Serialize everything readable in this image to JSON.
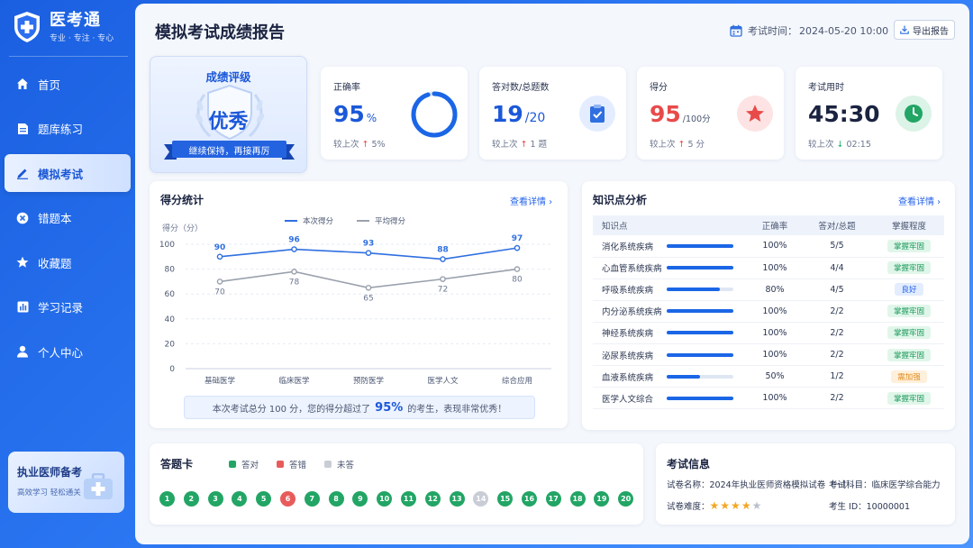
{
  "app": {
    "name": "医考通",
    "slogan": "专业 · 专注 · 专心"
  },
  "sidebar": {
    "items": [
      {
        "label": "首页",
        "icon": "home-icon",
        "active": false
      },
      {
        "label": "题库练习",
        "icon": "document-icon",
        "active": false
      },
      {
        "label": "模拟考试",
        "icon": "pencil-icon",
        "active": true
      },
      {
        "label": "错题本",
        "icon": "close-circle-icon",
        "active": false
      },
      {
        "label": "收藏题",
        "icon": "star-icon",
        "active": false
      },
      {
        "label": "学习记录",
        "icon": "bar-chart-icon",
        "active": false
      },
      {
        "label": "个人中心",
        "icon": "user-icon",
        "active": false
      }
    ],
    "promo": {
      "title": "执业医师备考",
      "subtitle": "高效学习 轻松通关"
    }
  },
  "header": {
    "title": "模拟考试成绩报告",
    "exam_time_label": "考试时间：",
    "exam_time": "2024-05-20 10:00",
    "export_label": "导出报告"
  },
  "grade": {
    "label": "成绩评级",
    "value": "优秀",
    "ribbon": "继续保持，再接再厉"
  },
  "stats": {
    "accuracy": {
      "title": "正确率",
      "value": "95",
      "unit": "%",
      "compare_prefix": "较上次",
      "arrow": "↑",
      "delta": "5%",
      "fraction": 0.95
    },
    "correct": {
      "title": "答对数/总题数",
      "value": "19",
      "unit": "/20",
      "compare_prefix": "较上次",
      "arrow": "↑",
      "delta": "1 题"
    },
    "score": {
      "title": "得分",
      "value": "95",
      "unit": "/100分",
      "compare_prefix": "较上次",
      "arrow": "↑",
      "delta": "5 分"
    },
    "duration": {
      "title": "考试用时",
      "value": "45:30",
      "compare_prefix": "较上次",
      "arrow": "↓",
      "delta": "02:15"
    }
  },
  "score_chart": {
    "title": "得分统计",
    "link": "查看详情 ›",
    "summary_before": "本次考试总分 100 分，您的得分超过了",
    "summary_pct": "95%",
    "summary_after": "的考生，表现非常优秀！"
  },
  "chart_data": {
    "type": "line",
    "ylabel": "得分（分）",
    "ylim": [
      0,
      100
    ],
    "yticks": [
      0,
      20,
      40,
      60,
      80,
      100
    ],
    "categories": [
      "基础医学",
      "临床医学",
      "预防医学",
      "医学人文",
      "综合应用"
    ],
    "series": [
      {
        "name": "本次得分",
        "values": [
          90,
          96,
          93,
          88,
          97
        ],
        "color": "#2f6fe0"
      },
      {
        "name": "平均得分",
        "values": [
          70,
          78,
          65,
          72,
          80
        ],
        "color": "#9aa1ad"
      }
    ],
    "grid": true,
    "legend": "top-center"
  },
  "knowledge": {
    "title": "知识点分析",
    "link": "查看详情 ›",
    "headers": [
      "知识点",
      "正确率",
      "答对/总题",
      "掌握程度"
    ],
    "rows": [
      {
        "name": "消化系统疾病",
        "rate": "100%",
        "fraction": 1.0,
        "answered": "5/5",
        "level": "掌握牢固",
        "level_type": "good"
      },
      {
        "name": "心血管系统疾病",
        "rate": "100%",
        "fraction": 1.0,
        "answered": "4/4",
        "level": "掌握牢固",
        "level_type": "good"
      },
      {
        "name": "呼吸系统疾病",
        "rate": "80%",
        "fraction": 0.8,
        "answered": "4/5",
        "level": "良好",
        "level_type": "ok"
      },
      {
        "name": "内分泌系统疾病",
        "rate": "100%",
        "fraction": 1.0,
        "answered": "2/2",
        "level": "掌握牢固",
        "level_type": "good"
      },
      {
        "name": "神经系统疾病",
        "rate": "100%",
        "fraction": 1.0,
        "answered": "2/2",
        "level": "掌握牢固",
        "level_type": "good"
      },
      {
        "name": "泌尿系统疾病",
        "rate": "100%",
        "fraction": 1.0,
        "answered": "2/2",
        "level": "掌握牢固",
        "level_type": "good"
      },
      {
        "name": "血液系统疾病",
        "rate": "50%",
        "fraction": 0.5,
        "answered": "1/2",
        "level": "需加强",
        "level_type": "weak"
      },
      {
        "name": "医学人文综合",
        "rate": "100%",
        "fraction": 1.0,
        "answered": "2/2",
        "level": "掌握牢固",
        "level_type": "good"
      }
    ]
  },
  "answer_sheet": {
    "title": "答题卡",
    "legend": {
      "correct": "答对",
      "wrong": "答错",
      "unanswered": "未答"
    },
    "colors": {
      "correct": "#22a565",
      "wrong": "#e85b5b",
      "unanswered": "#c9cdd6"
    },
    "questions": [
      {
        "no": "1",
        "status": "correct"
      },
      {
        "no": "2",
        "status": "correct"
      },
      {
        "no": "3",
        "status": "correct"
      },
      {
        "no": "4",
        "status": "correct"
      },
      {
        "no": "5",
        "status": "correct"
      },
      {
        "no": "6",
        "status": "wrong"
      },
      {
        "no": "7",
        "status": "correct"
      },
      {
        "no": "8",
        "status": "correct"
      },
      {
        "no": "9",
        "status": "correct"
      },
      {
        "no": "10",
        "status": "correct"
      },
      {
        "no": "11",
        "status": "correct"
      },
      {
        "no": "12",
        "status": "correct"
      },
      {
        "no": "13",
        "status": "correct"
      },
      {
        "no": "14",
        "status": "unanswered"
      },
      {
        "no": "15",
        "status": "correct"
      },
      {
        "no": "16",
        "status": "correct"
      },
      {
        "no": "17",
        "status": "correct"
      },
      {
        "no": "18",
        "status": "correct"
      },
      {
        "no": "19",
        "status": "correct"
      },
      {
        "no": "20",
        "status": "correct"
      }
    ]
  },
  "exam_info": {
    "title": "考试信息",
    "paper_label": "试卷名称：",
    "paper": "2024年执业医师资格模拟试卷（一）",
    "subject_label": "考试科目：",
    "subject": "临床医学综合能力",
    "difficulty_label": "试卷难度：",
    "difficulty_stars": 4,
    "difficulty_max": 5,
    "id_label": "考生 ID：",
    "student_id": "10000001"
  }
}
